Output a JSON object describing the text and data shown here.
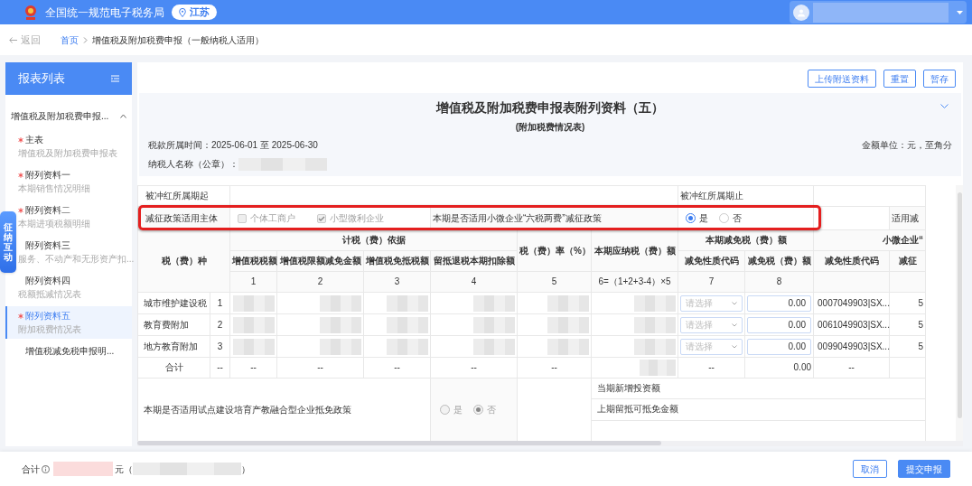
{
  "header": {
    "site_title": "全国统一规范电子税务局",
    "region": "江苏"
  },
  "breadcrumb": {
    "back": "返回",
    "items": [
      "首页",
      "增值税及附加税费申报（一般纳税人适用）"
    ]
  },
  "sidebar": {
    "title": "报表列表",
    "group": {
      "label": "增值税及附加税费申报...",
      "expanded": true,
      "items": [
        {
          "title": "主表",
          "subtitle": "增值税及附加税费申报表",
          "required": true,
          "selected": false
        },
        {
          "title": "附列资料一",
          "subtitle": "本期销售情况明细",
          "required": true,
          "selected": false
        },
        {
          "title": "附列资料二",
          "subtitle": "本期进项税额明细",
          "required": true,
          "selected": false
        },
        {
          "title": "附列资料三",
          "subtitle": "服务、不动产和无形资产扣...",
          "required": false,
          "selected": false
        },
        {
          "title": "附列资料四",
          "subtitle": "税额抵减情况表",
          "required": false,
          "selected": false
        },
        {
          "title": "附列资料五",
          "subtitle": "附加税费情况表",
          "required": true,
          "selected": true
        },
        {
          "title": "增值税减免税申报明...",
          "required": false,
          "selected": false
        }
      ]
    }
  },
  "floating_tab": "征纳互动",
  "toolbar": [
    "上传附送资料",
    "重置",
    "暂存"
  ],
  "form": {
    "title": "增值税及附加税费申报表附列资料（五）",
    "subtitle": "(附加税费情况表)",
    "period": "税款所属时间：2025-06-01 至 2025-06-30",
    "unit": "金额单位：元，至角分",
    "taxpayer_label": "纳税人名称（公章）："
  },
  "table": {
    "offset_start_label": "被冲红所属期起",
    "offset_end_label": "被冲红所属期止",
    "policy_subject_label": "减征政策适用主体",
    "policy_subjects": [
      {
        "label": "个体工商户",
        "checked": false
      },
      {
        "label": "小型微利企业",
        "checked": true
      }
    ],
    "six_taxes_question": "本期是否适用小微企业“六税两费”减征政策",
    "six_taxes_options": [
      {
        "label": "是",
        "selected": true
      },
      {
        "label": "否",
        "selected": false
      }
    ],
    "cut_label": "适用减",
    "tax_type_header": "税（费）种",
    "basis_header": "计税（费）依据",
    "basis_columns": [
      "增值税税额",
      "增值税限额减免金额",
      "增值税免抵税额",
      "留抵退税本期扣除额"
    ],
    "rate_header": "税（费）率（%）",
    "payable_header": "本期应纳税（费）额",
    "relief_header": "本期减免税（费）额",
    "relief_columns": [
      "减免性质代码",
      "减免税（费）额"
    ],
    "small_header": "小微企业“",
    "small_columns": [
      "减免性质代码",
      "减征"
    ],
    "column_numbers": [
      "1",
      "2",
      "3",
      "4",
      "5",
      "6=（1+2+3-4）×5",
      "7",
      "8"
    ],
    "rows": [
      {
        "name": "城市维护建设税",
        "index": "1",
        "code_placeholder": "请选择",
        "relief": "0.00",
        "small_code": "0007049903|SX...",
        "cut": "5"
      },
      {
        "name": "教育费附加",
        "index": "2",
        "code_placeholder": "请选择",
        "relief": "0.00",
        "small_code": "0061049903|SX...",
        "cut": "5"
      },
      {
        "name": "地方教育附加",
        "index": "3",
        "code_placeholder": "请选择",
        "relief": "0.00",
        "small_code": "0099049903|SX...",
        "cut": "5"
      }
    ],
    "total": {
      "label": "合计",
      "index": "--",
      "basis": [
        "--",
        "--",
        "--",
        "--"
      ],
      "rate": "--",
      "code": "--",
      "relief": "0.00",
      "small_code": "--"
    },
    "pilot_question": "本期是否适用试点建设培育产教融合型企业抵免政策",
    "pilot_options": [
      {
        "label": "是",
        "selected": false
      },
      {
        "label": "否",
        "selected": true
      }
    ],
    "pilot_fields": [
      "当期新增投资额",
      "上期留抵可抵免金额"
    ]
  },
  "footer": {
    "total_label": "合计",
    "unit": "元（",
    "close": "）",
    "buttons": [
      {
        "label": "取消",
        "kind": "outline"
      },
      {
        "label": "提交申报",
        "kind": "primary"
      }
    ]
  }
}
